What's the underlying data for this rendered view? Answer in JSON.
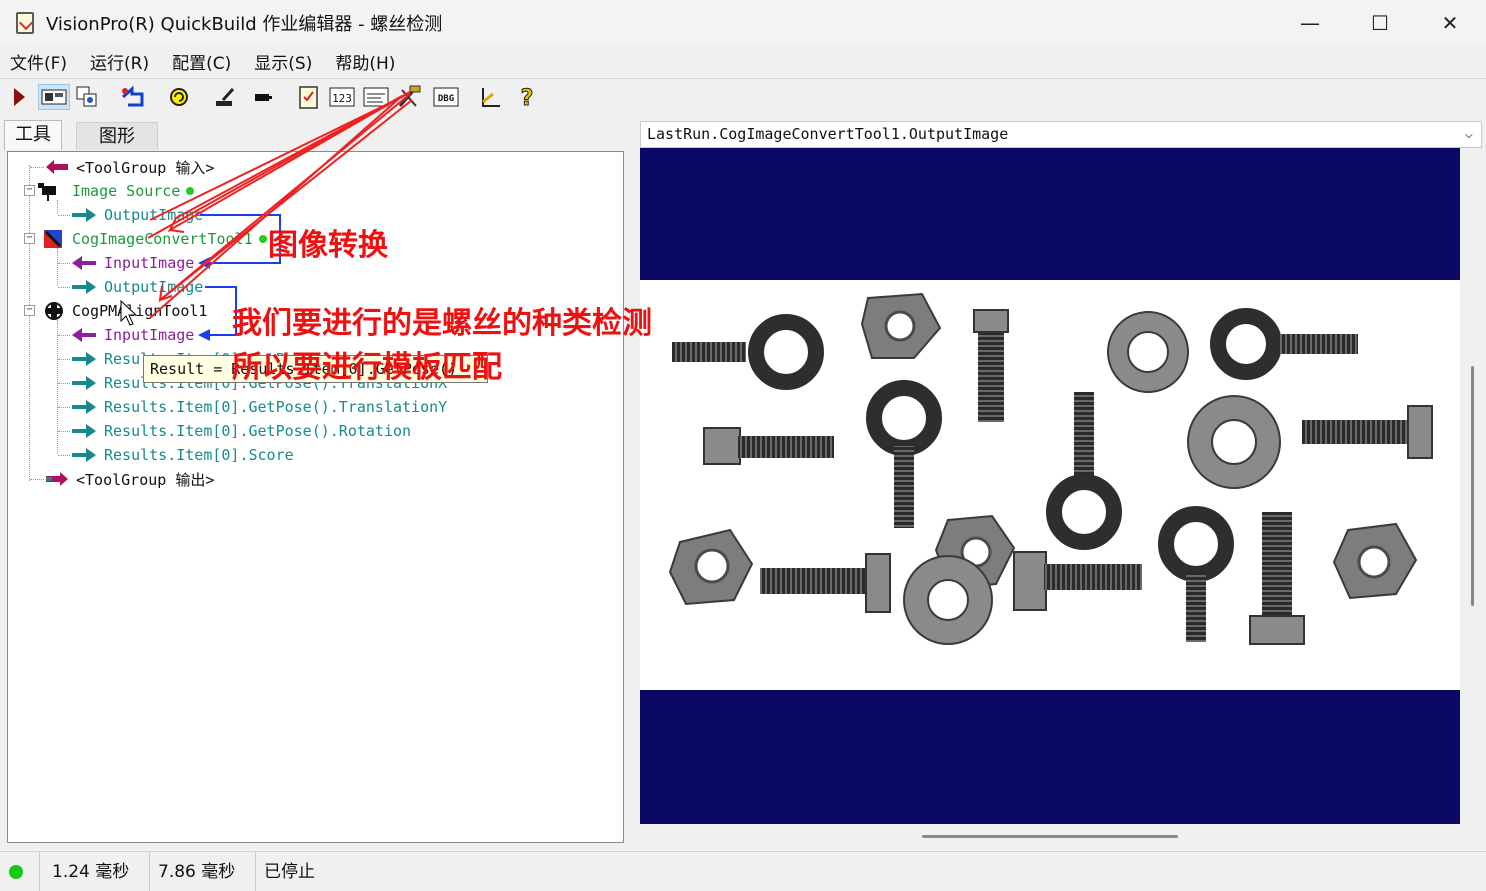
{
  "window": {
    "title": "VisionPro(R) QuickBuild 作业编辑器 - 螺丝检测",
    "minimize": "—",
    "maximize": "☐",
    "close": "✕"
  },
  "menu": [
    "文件(F)",
    "运行(R)",
    "配置(C)",
    "显示(S)",
    "帮助(H)"
  ],
  "toolbar": {
    "icons": [
      "run-icon",
      "toggle-display-icon",
      "copy-tool-icon",
      "reset-icon",
      "rotate-icon",
      "edit-icon",
      "pin-icon",
      "job-properties-icon",
      "number-icon",
      "terminal-icon",
      "tools-icon",
      "dbg-icon",
      "measure-icon",
      "help-icon"
    ],
    "dbg_label": "DBG",
    "num_label": "123"
  },
  "tabs": [
    "工具",
    "图形"
  ],
  "tree": {
    "input_group": "<ToolGroup 输入>",
    "image_source": "Image Source",
    "image_source_output": "OutputImage",
    "convert_tool": "CogImageConvertTool1",
    "convert_input": "InputImage",
    "convert_output": "OutputImage",
    "pm_tool": "CogPMAlignTool1",
    "pm_input": "InputImage",
    "pm_results": [
      "Results.Item[0].GetPose()",
      "Results.Item[0].GetPose().TranslationX",
      "Results.Item[0].GetPose().TranslationY",
      "Results.Item[0].GetPose().Rotation",
      "Results.Item[0].Score"
    ],
    "output_group": "<ToolGroup 输出>"
  },
  "tooltip": "Result = Results.Item[0].GetPose()",
  "display": {
    "selected_image": "LastRun.CogImageConvertTool1.OutputImage",
    "band_color": "#0a0a66"
  },
  "status": {
    "time1": "1.24 毫秒",
    "time2": "7.86 毫秒",
    "state": "已停止",
    "led_color": "#11cc11"
  },
  "annotations": {
    "label1": "图像转换",
    "label2": "我们要进行的是螺丝的种类检测",
    "label3": "所以要进行模板匹配",
    "color": "#ee1111"
  }
}
